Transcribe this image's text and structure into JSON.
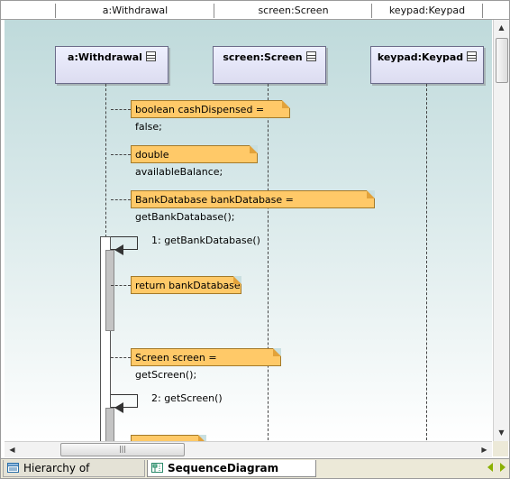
{
  "header": {
    "columns": [
      "a:Withdrawal",
      "screen:Screen",
      "keypad:Keypad"
    ]
  },
  "lifelines": [
    {
      "title": "a:Withdrawal"
    },
    {
      "title": "screen:Screen"
    },
    {
      "title": "keypad:Keypad"
    }
  ],
  "notes": [
    "boolean cashDispensed = false;",
    "double availableBalance;",
    "BankDatabase bankDatabase = getBankDatabase();",
    "return bankDatabase",
    "Screen screen = getScreen();",
    ""
  ],
  "messages": [
    "1: getBankDatabase()",
    "2: getScreen()"
  ],
  "icons": {
    "lifeline_menu": "list-icon",
    "tab_hierarchy": "hierarchy-icon",
    "tab_sequence": "sequence-diagram-icon"
  },
  "tabs": [
    {
      "label": "Hierarchy of Withdrawal",
      "active": false
    },
    {
      "label": "SequenceDiagram execute",
      "active": true
    }
  ],
  "colors": {
    "note_fill": "#ffc968",
    "lifeline_fill": "#dcdcf0",
    "canvas_top": "#bfdadb",
    "nav_arrow": "#8ab000"
  }
}
